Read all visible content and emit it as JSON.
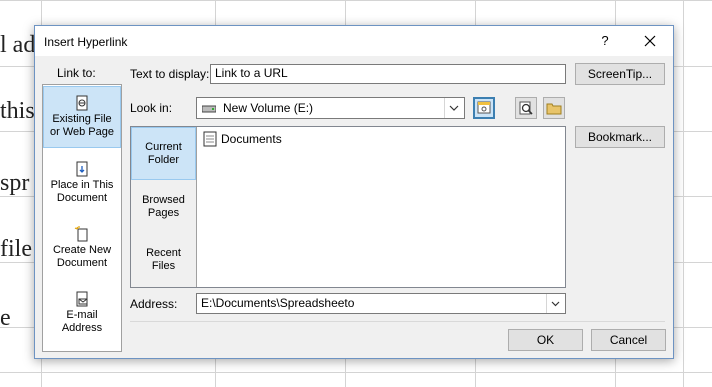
{
  "background": {
    "cell_fragments": [
      "l ad",
      "this",
      "spr",
      "file",
      "e"
    ]
  },
  "dialog": {
    "title": "Insert Hyperlink",
    "help": "?",
    "link_to_label": "Link to:",
    "link_to_items": [
      {
        "label_line1": "Existing File",
        "label_line2": "or Web Page",
        "icon": "web-page-file-icon",
        "selected": true
      },
      {
        "label_line1": "Place in This",
        "label_line2": "Document",
        "icon": "document-place-icon",
        "selected": false
      },
      {
        "label_line1": "Create New",
        "label_line2": "Document",
        "icon": "new-document-icon",
        "selected": false
      },
      {
        "label_line1": "E-mail",
        "label_line2": "Address",
        "icon": "email-icon",
        "selected": false
      }
    ],
    "text_to_display_label": "Text to display:",
    "text_to_display_value": "Link to a URL",
    "screentip_label": "ScreenTip...",
    "look_in_label": "Look in:",
    "look_in_value": "New Volume (E:)",
    "bookmark_label": "Bookmark...",
    "browse_tabs": [
      {
        "line1": "Current",
        "line2": "Folder",
        "selected": true
      },
      {
        "line1": "Browsed",
        "line2": "Pages",
        "selected": false
      },
      {
        "line1": "Recent",
        "line2": "Files",
        "selected": false
      }
    ],
    "files": [
      {
        "name": "Documents",
        "icon": "folder-icon"
      }
    ],
    "address_label": "Address:",
    "address_value": "E:\\Documents\\Spreadsheeto",
    "ok_label": "OK",
    "cancel_label": "Cancel",
    "colors": {
      "accent": "#cce4f7",
      "accent_border": "#99c9ef",
      "dialog_border": "#6d93c2"
    }
  }
}
